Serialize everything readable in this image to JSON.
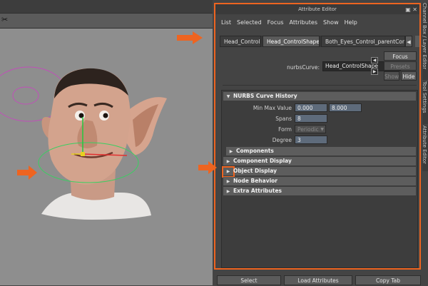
{
  "colors": {
    "highlight_border": "#ee6420",
    "viewport_bg": "#8e8e8e",
    "panel_bg": "#444444",
    "field_bg": "#5e6b7b",
    "curve_magenta": "#c050b8",
    "curve_green": "#38d060",
    "axis_red": "#e23030",
    "axis_green": "#22c840",
    "axis_yellow": "#e8d020"
  },
  "viewport": {
    "toolbar_icon": "scissors-icon",
    "toolbar_icon_glyph": "✂"
  },
  "attribute_editor": {
    "title": "Attribute Editor",
    "menu": [
      "List",
      "Selected",
      "Focus",
      "Attributes",
      "Show",
      "Help"
    ],
    "tabs": [
      "Head_Control",
      "Head_ControlShape",
      "Both_Eyes_Control_parentConstr"
    ],
    "active_tab": 1,
    "node_type_label": "nurbsCurve:",
    "node_name": "Head_ControlShape",
    "buttons": {
      "focus": "Focus",
      "presets": "Presets",
      "show": "Show",
      "hide": "Hide"
    },
    "sections": {
      "nurbs_history": "NURBS Curve History",
      "components": "Components",
      "component_display": "Component Display",
      "object_display": "Object Display",
      "node_behavior": "Node Behavior",
      "extra_attributes": "Extra Attributes"
    },
    "fields": {
      "min_max_label": "Min Max Value",
      "min_value": "0.000",
      "max_value": "8.000",
      "spans_label": "Spans",
      "spans_value": "8",
      "form_label": "Form",
      "form_value": "Periodic",
      "degree_label": "Degree",
      "degree_value": "3"
    }
  },
  "side_tabs": [
    "Channel Box / Layer Editor",
    "Tool Settings",
    "Attribute Editor"
  ],
  "bottom_buttons": [
    "Select",
    "Load Attributes",
    "Copy Tab"
  ]
}
